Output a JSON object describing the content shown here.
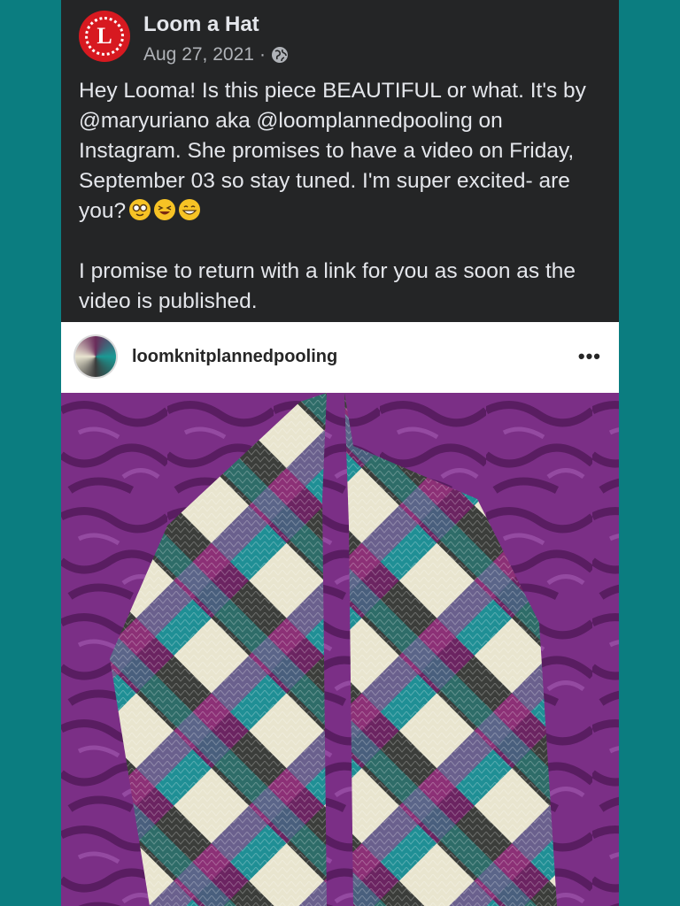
{
  "post": {
    "page_name": "Loom a Hat",
    "avatar_letter": "L",
    "date": "Aug 27, 2021",
    "separator": "·",
    "paragraph1": "Hey Looma! Is this piece BEAUTIFUL or what. It's by @maryuriano aka @loomplannedpooling on Instagram. She promises to have a video on Friday, September 03 so stay tuned. I'm super excited- are you?",
    "paragraph2": "I promise to return with a link for you as soon as the video is published.",
    "emojis": [
      "nerd-face-emoji",
      "laughing-emoji",
      "grinning-emoji"
    ]
  },
  "embed": {
    "username": "loomknitplannedpooling",
    "more": "•••"
  },
  "colors": {
    "background": "#0b7d80",
    "card": "#242526",
    "avatar_red": "#d71920"
  }
}
